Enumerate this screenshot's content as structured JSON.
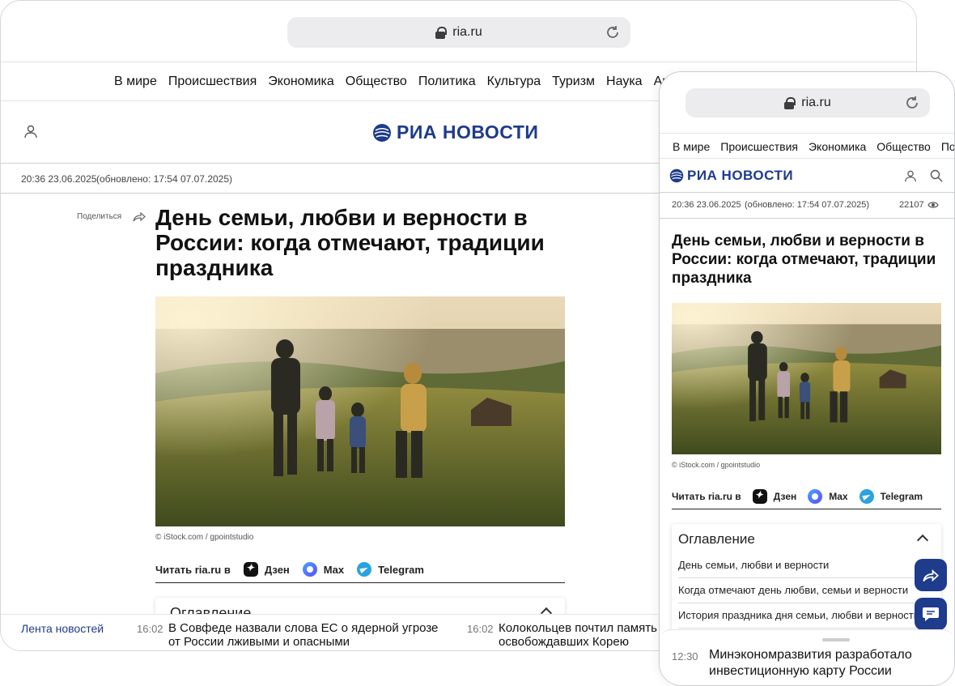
{
  "desktop": {
    "url": "ria.ru",
    "nav": [
      "В мире",
      "Происшествия",
      "Экономика",
      "Общество",
      "Политика",
      "Культура",
      "Туризм",
      "Наука",
      "Ар"
    ],
    "logo_text": "РИА НОВОСТИ",
    "timestamp": "20:36 23.06.2025",
    "updated": "(обновлено: 17:54 07.07.2025)",
    "share_label": "Поделиться",
    "title": "День семьи, любви и верности в России: когда отмечают, традиции праздника",
    "photo_credit": "© iStock.com / gpointstudio",
    "read_in": {
      "label": "Читать ria.ru в",
      "dzen": "Дзен",
      "max": "Max",
      "telegram": "Telegram"
    },
    "toc_title": "Оглавление",
    "ticker": {
      "label": "Лента новостей",
      "items": [
        {
          "time": "16:02",
          "text": "В Совфеде назвали слова ЕС о ядерной угрозе от России лживыми и опасными"
        },
        {
          "time": "16:02",
          "text": "Колокольцев почтил память с освобождавших Корею"
        }
      ]
    }
  },
  "mobile": {
    "url": "ria.ru",
    "nav": [
      "В мире",
      "Происшествия",
      "Экономика",
      "Общество",
      "По"
    ],
    "logo_text": "РИА НОВОСТИ",
    "timestamp": "20:36 23.06.2025",
    "updated": "(обновлено: 17:54 07.07.2025)",
    "views": "22107",
    "title": "День семьи, любви и верности в России: когда отмечают, традиции праздника",
    "photo_credit": "© iStock.com / gpointstudio",
    "read_in": {
      "label": "Читать ria.ru в",
      "dzen": "Дзен",
      "max": "Max",
      "telegram": "Telegram"
    },
    "toc": {
      "title": "Оглавление",
      "items": [
        "День семьи, любви и верности",
        "Когда отмечают день любви, семьи и верности",
        "История праздника дня семьи, любви и верности"
      ]
    },
    "bottom_news": {
      "time": "12:30",
      "text": "Минэкономразвития разработало инвестиционную карту России"
    }
  },
  "colors": {
    "brand": "#1e3b8c",
    "url_bar": "#ececee"
  }
}
